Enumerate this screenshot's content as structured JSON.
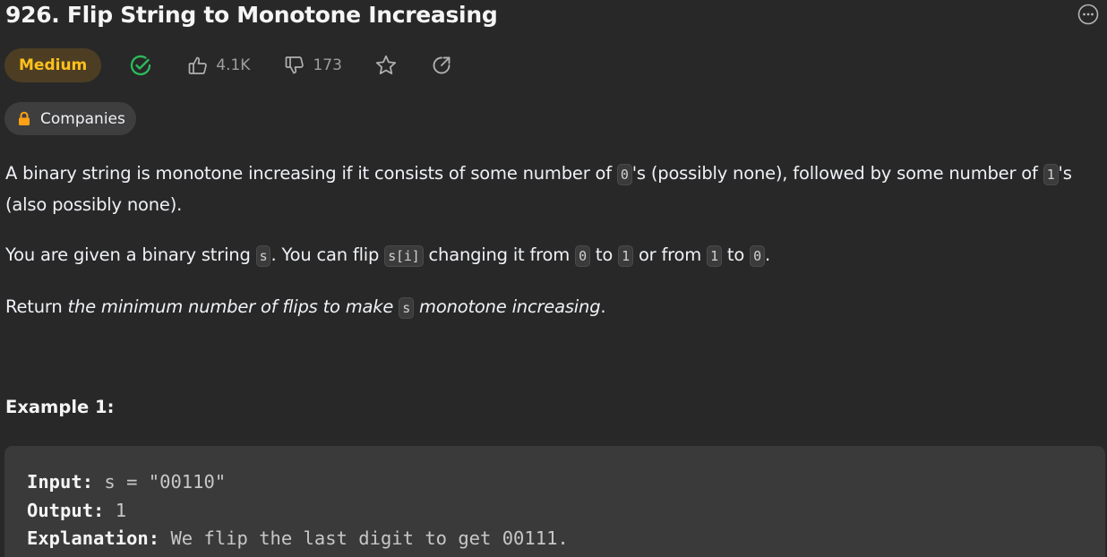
{
  "problem": {
    "title": "926. Flip String to Monotone Increasing",
    "difficulty": "Medium",
    "likes": "4.1K",
    "dislikes": "173",
    "companies_label": "Companies"
  },
  "icons": {
    "solved": "check-circle-icon",
    "like": "thumbs-up-icon",
    "dislike": "thumbs-down-icon",
    "favorite": "star-icon",
    "share": "share-icon",
    "companies": "lock-icon",
    "more": "more-options-icon"
  },
  "colors": {
    "background": "#282828",
    "difficulty_medium": "#ffc01e",
    "solved_green": "#2cbb5d",
    "code_bg": "#3b3b3b",
    "example_bg": "#3a3a3a"
  },
  "description": {
    "p1": {
      "t1": "A binary string is monotone increasing if it consists of some number of ",
      "c1": "0",
      "t2": "'s (possibly none), followed by some number of ",
      "c2": "1",
      "t3": "'s (also possibly none)."
    },
    "p2": {
      "t1": "You are given a binary string ",
      "c1": "s",
      "t2": ". You can flip ",
      "c2": "s[i]",
      "t3": " changing it from ",
      "c3": "0",
      "t4": " to ",
      "c4": "1",
      "t5": " or from ",
      "c5": "1",
      "t6": " to ",
      "c6": "0",
      "t7": "."
    },
    "p3": {
      "t1": "Return ",
      "e1": "the minimum number of flips to make ",
      "c1": "s",
      "e2": " monotone increasing",
      "t2": "."
    }
  },
  "example": {
    "title": "Example 1:",
    "input_label": "Input:",
    "input_value": " s = \"00110\"",
    "output_label": "Output:",
    "output_value": " 1",
    "explanation_label": "Explanation:",
    "explanation_value": " We flip the last digit to get 00111."
  }
}
